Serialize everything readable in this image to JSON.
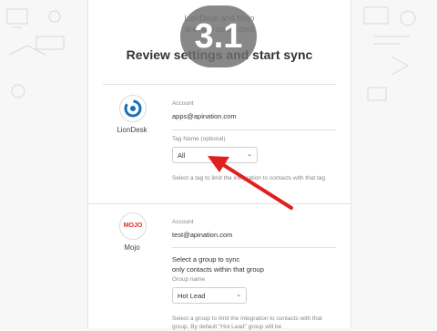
{
  "header": {
    "top_line_1": "LionDesk and Mojo",
    "top_line_2": "are now connected",
    "title": "Review settings and start sync",
    "step_badge": "3.1"
  },
  "liondesk": {
    "name": "LionDesk",
    "logo_icon": "liondesk-logo-icon",
    "account_label": "Account",
    "account_value": "apps@apination.com",
    "tag_label": "Tag Name (optional)",
    "tag_value": "All",
    "tag_help": "Select a tag to limit the integration to contacts with that tag"
  },
  "mojo": {
    "name": "Mojo",
    "logo_text": "MOJO",
    "account_label": "Account",
    "account_value": "test@apination.com",
    "group_intro_1": "Select a group to sync",
    "group_intro_2": "only contacts within that group",
    "group_label": "Group name",
    "group_value": "Hot Lead",
    "group_help": "Select a group to limit the integration to contacts with that group. By default \"Hot Lead\" group will be"
  },
  "colors": {
    "arrow": "#e0201f",
    "badge": "#6e6e6e",
    "liondesk_blue": "#1a6fb5",
    "mojo_red": "#d9322b"
  }
}
